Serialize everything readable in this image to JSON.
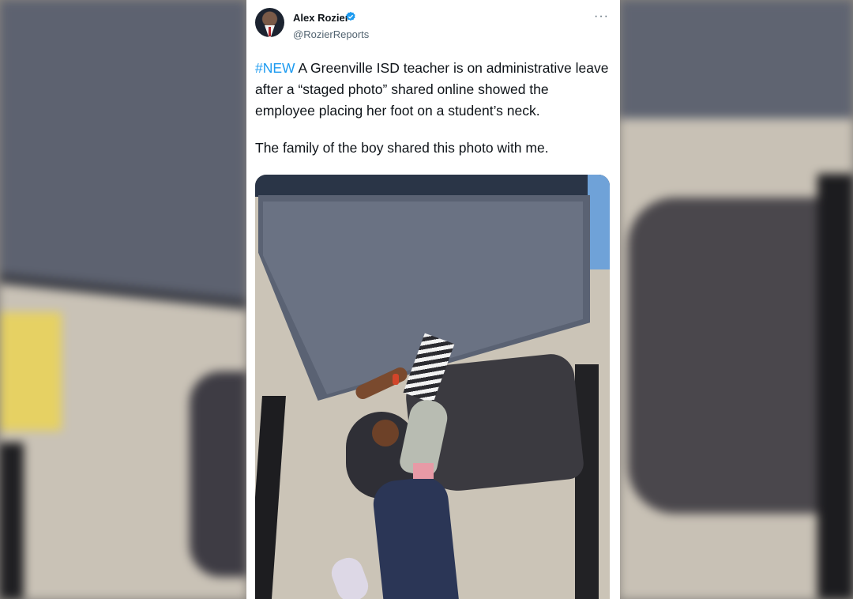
{
  "tweet": {
    "author_name": "Alex Rozier",
    "author_handle": "@RozierReports",
    "more_label": "···",
    "hashtag": "#NEW",
    "line1_rest": " A Greenville ISD teacher is on administrative leave after a “staged photo” shared online showed the employee placing her foot on a student’s neck.",
    "line2": "The family of the boy shared this photo with me."
  },
  "icons": {
    "verified": "verified-badge-icon",
    "more": "more-options-icon"
  },
  "colors": {
    "hashtag": "#1d9bf0",
    "verified": "#1d9bf0",
    "text": "#0f1419",
    "secondary": "#536471"
  }
}
